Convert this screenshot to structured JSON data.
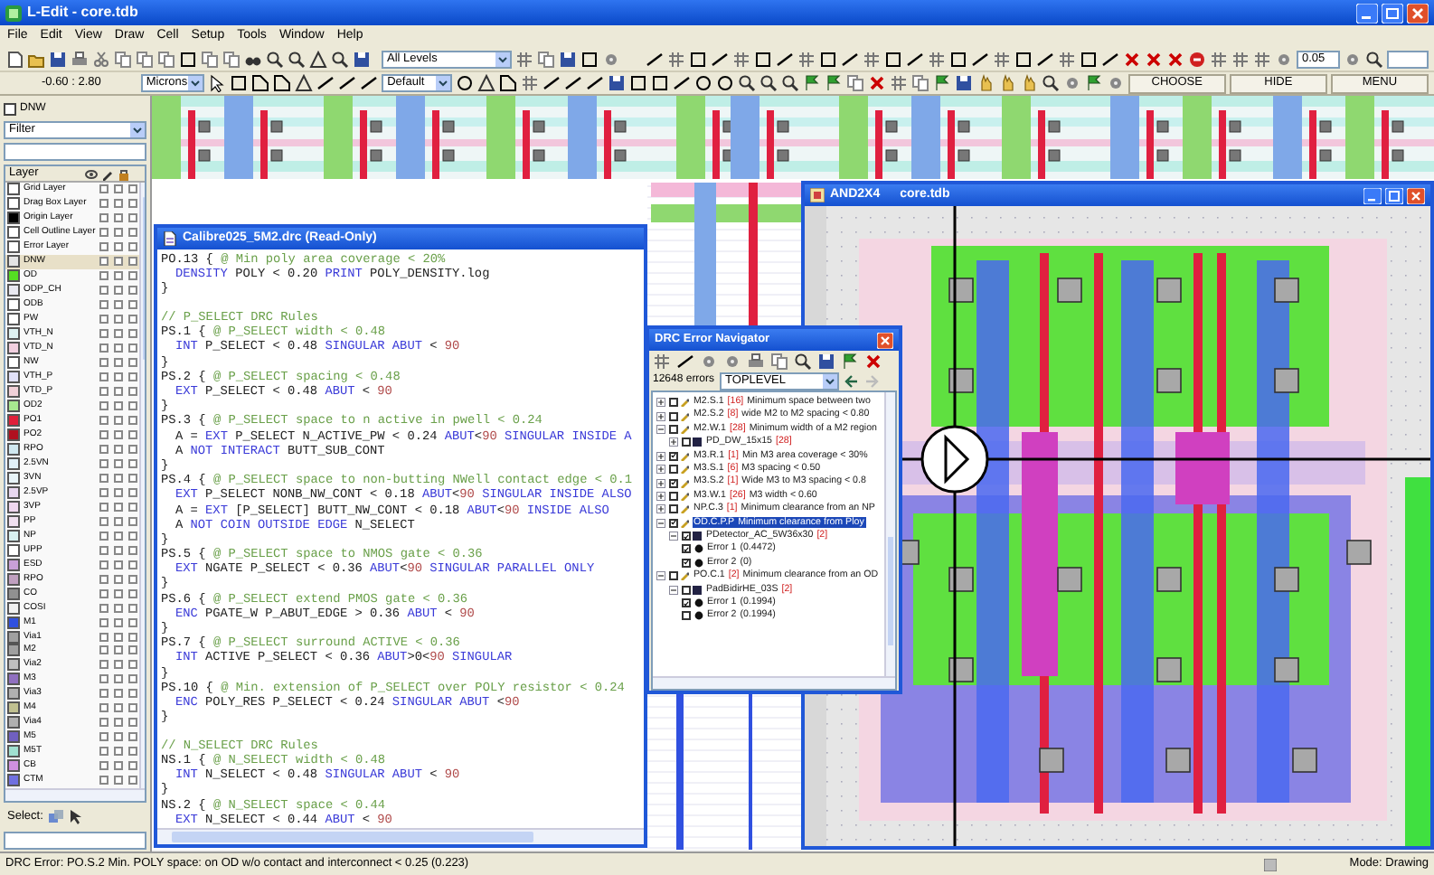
{
  "window": {
    "title": "L-Edit - core.tdb"
  },
  "menu": [
    "File",
    "Edit",
    "View",
    "Draw",
    "Cell",
    "Setup",
    "Tools",
    "Window",
    "Help"
  ],
  "toolbar": {
    "level_dropdown": "All Levels",
    "snap_field": "0.05",
    "coordinates": "-0.60 : 2.80",
    "units_dropdown": "Microns",
    "style_dropdown": "Default",
    "buttons": [
      "CHOOSE",
      "HIDE",
      "MENU"
    ]
  },
  "layer_panel": {
    "top_checkbox": {
      "label": "DNW",
      "checked": false
    },
    "filter": "Filter",
    "header": "Layer",
    "select_label": "Select:",
    "layers": [
      {
        "name": "Grid Layer",
        "color": "#ffffff",
        "selected": false,
        "flags": [
          false,
          false,
          false
        ]
      },
      {
        "name": "Drag Box Layer",
        "color": "#ffffff",
        "selected": false,
        "flags": [
          false,
          false,
          false
        ]
      },
      {
        "name": "Origin Layer",
        "color": "#000000",
        "selected": false,
        "flags": [
          false,
          false,
          false
        ]
      },
      {
        "name": "Cell Outline Layer",
        "color": "#ffffff",
        "selected": false,
        "flags": [
          false,
          false,
          false
        ]
      },
      {
        "name": "Error Layer",
        "color": "#ffffff",
        "selected": false,
        "flags": [
          false,
          false,
          false
        ]
      },
      {
        "name": "DNW",
        "color": "#e4e4e4",
        "selected": true,
        "flags": [
          false,
          false,
          false
        ]
      },
      {
        "name": "OD",
        "color": "#55dd22",
        "selected": false,
        "flags": [
          false,
          false,
          false
        ]
      },
      {
        "name": "ODP_CH",
        "color": "#e8e8f0",
        "selected": false,
        "flags": [
          false,
          false,
          false
        ]
      },
      {
        "name": "ODB",
        "color": "#ffffff",
        "selected": false,
        "flags": [
          false,
          false,
          false
        ]
      },
      {
        "name": "PW",
        "color": "#ffffff",
        "selected": false,
        "flags": [
          false,
          false,
          false
        ]
      },
      {
        "name": "VTH_N",
        "color": "#dff2f2",
        "selected": false,
        "flags": [
          false,
          false,
          false
        ]
      },
      {
        "name": "VTD_N",
        "color": "#f2d0e0",
        "selected": false,
        "flags": [
          false,
          false,
          false
        ]
      },
      {
        "name": "NW",
        "color": "#ffffff",
        "selected": false,
        "flags": [
          false,
          false,
          false
        ]
      },
      {
        "name": "VTH_P",
        "color": "#e0e0f8",
        "selected": false,
        "flags": [
          false,
          false,
          false
        ]
      },
      {
        "name": "VTD_P",
        "color": "#f0d0d8",
        "selected": false,
        "flags": [
          false,
          false,
          false
        ]
      },
      {
        "name": "OD2",
        "color": "#a8e890",
        "selected": false,
        "flags": [
          false,
          false,
          false
        ]
      },
      {
        "name": "PO1",
        "color": "#e0203a",
        "selected": false,
        "flags": [
          false,
          false,
          false
        ]
      },
      {
        "name": "PO2",
        "color": "#b01020",
        "selected": false,
        "flags": [
          false,
          false,
          false
        ]
      },
      {
        "name": "RPO",
        "color": "#d0e8f0",
        "selected": false,
        "flags": [
          false,
          false,
          false
        ]
      },
      {
        "name": "2.5VN",
        "color": "#e0f0f8",
        "selected": false,
        "flags": [
          false,
          false,
          false
        ]
      },
      {
        "name": "3VN",
        "color": "#e8f4f8",
        "selected": false,
        "flags": [
          false,
          false,
          false
        ]
      },
      {
        "name": "2.5VP",
        "color": "#e8d8f0",
        "selected": false,
        "flags": [
          false,
          false,
          false
        ]
      },
      {
        "name": "3VP",
        "color": "#f0d8f0",
        "selected": false,
        "flags": [
          false,
          false,
          false
        ]
      },
      {
        "name": "PP",
        "color": "#f0e0f0",
        "selected": false,
        "flags": [
          false,
          false,
          false
        ]
      },
      {
        "name": "NP",
        "color": "#d8f0f0",
        "selected": false,
        "flags": [
          false,
          false,
          false
        ]
      },
      {
        "name": "UPP",
        "color": "#ffffff",
        "selected": false,
        "flags": [
          false,
          false,
          false
        ]
      },
      {
        "name": "ESD",
        "color": "#c8a0d8",
        "selected": false,
        "flags": [
          false,
          false,
          false
        ]
      },
      {
        "name": "RPO",
        "color": "#c0a0c0",
        "selected": false,
        "flags": [
          false,
          false,
          false
        ]
      },
      {
        "name": "CO",
        "color": "#909090",
        "selected": false,
        "flags": [
          false,
          false,
          false
        ]
      },
      {
        "name": "COSI",
        "color": "#f0f0f0",
        "selected": false,
        "flags": [
          false,
          false,
          false
        ]
      },
      {
        "name": "M1",
        "color": "#3050e0",
        "selected": false,
        "flags": [
          false,
          false,
          false
        ]
      },
      {
        "name": "Via1",
        "color": "#a0a0a0",
        "selected": false,
        "flags": [
          false,
          false,
          false
        ]
      },
      {
        "name": "M2",
        "color": "#a0a0a0",
        "selected": false,
        "flags": [
          false,
          false,
          false
        ]
      },
      {
        "name": "Via2",
        "color": "#c0c0c0",
        "selected": false,
        "flags": [
          false,
          false,
          false
        ]
      },
      {
        "name": "M3",
        "color": "#9070c0",
        "selected": false,
        "flags": [
          false,
          false,
          false
        ]
      },
      {
        "name": "Via3",
        "color": "#b0b0b0",
        "selected": false,
        "flags": [
          false,
          false,
          false
        ]
      },
      {
        "name": "M4",
        "color": "#c0c090",
        "selected": false,
        "flags": [
          false,
          false,
          false
        ]
      },
      {
        "name": "Via4",
        "color": "#b0b0b0",
        "selected": false,
        "flags": [
          false,
          false,
          false
        ]
      },
      {
        "name": "M5",
        "color": "#7060c0",
        "selected": false,
        "flags": [
          false,
          false,
          false
        ]
      },
      {
        "name": "M5T",
        "color": "#a0e0d0",
        "selected": false,
        "flags": [
          false,
          false,
          false
        ]
      },
      {
        "name": "CB",
        "color": "#d090e0",
        "selected": false,
        "flags": [
          false,
          false,
          false
        ]
      },
      {
        "name": "CTM",
        "color": "#7070e0",
        "selected": false,
        "flags": [
          false,
          false,
          false
        ]
      }
    ]
  },
  "code_window": {
    "title": "Calibre025_5M2.drc (Read-Only)",
    "lines": [
      {
        "kind": "text",
        "indented": false,
        "segments": [
          {
            "text": "PO.13 { ",
            "kind": "plain"
          },
          {
            "text": "@ Min poly area coverage < 20%",
            "kind": "comment"
          }
        ]
      },
      {
        "kind": "text",
        "indented": true,
        "segments": [
          {
            "text": "DENSITY",
            "kind": "keyword"
          },
          {
            "text": " POLY < 0.20 ",
            "kind": "plain"
          },
          {
            "text": "PRINT",
            "kind": "keyword"
          },
          {
            "text": " POLY_DENSITY.log",
            "kind": "plain"
          }
        ]
      },
      {
        "kind": "text",
        "indented": false,
        "segments": [
          {
            "text": "}",
            "kind": "plain"
          }
        ]
      },
      {
        "kind": "blank"
      },
      {
        "kind": "text",
        "indented": false,
        "segments": [
          {
            "text": "// P_SELECT DRC Rules",
            "kind": "comment"
          }
        ]
      },
      {
        "kind": "text",
        "indented": false,
        "segments": [
          {
            "text": "PS.1 { ",
            "kind": "plain"
          },
          {
            "text": "@ P_SELECT width < 0.48",
            "kind": "comment"
          }
        ]
      },
      {
        "kind": "text",
        "indented": true,
        "segments": [
          {
            "text": "INT",
            "kind": "keyword"
          },
          {
            "text": " P_SELECT < 0.48 ",
            "kind": "plain"
          },
          {
            "text": "SINGULAR ABUT",
            "kind": "keyword"
          },
          {
            "text": " < ",
            "kind": "plain"
          },
          {
            "text": "90",
            "kind": "number"
          }
        ]
      },
      {
        "kind": "text",
        "indented": false,
        "segments": [
          {
            "text": "}",
            "kind": "plain"
          }
        ]
      },
      {
        "kind": "text",
        "indented": false,
        "segments": [
          {
            "text": "PS.2 { ",
            "kind": "plain"
          },
          {
            "text": "@ P_SELECT spacing < 0.48",
            "kind": "comment"
          }
        ]
      },
      {
        "kind": "text",
        "indented": true,
        "segments": [
          {
            "text": "EXT",
            "kind": "keyword"
          },
          {
            "text": " P_SELECT < 0.48 ",
            "kind": "plain"
          },
          {
            "text": "ABUT",
            "kind": "keyword"
          },
          {
            "text": " < ",
            "kind": "plain"
          },
          {
            "text": "90",
            "kind": "number"
          }
        ]
      },
      {
        "kind": "text",
        "indented": false,
        "segments": [
          {
            "text": "}",
            "kind": "plain"
          }
        ]
      },
      {
        "kind": "text",
        "indented": false,
        "segments": [
          {
            "text": "PS.3 { ",
            "kind": "plain"
          },
          {
            "text": "@ P_SELECT space to n active in pwell < 0.24",
            "kind": "comment"
          }
        ]
      },
      {
        "kind": "text",
        "indented": true,
        "segments": [
          {
            "text": "A = ",
            "kind": "plain"
          },
          {
            "text": "EXT",
            "kind": "keyword"
          },
          {
            "text": " P_SELECT N_ACTIVE_PW < 0.24 ",
            "kind": "plain"
          },
          {
            "text": "ABUT",
            "kind": "keyword"
          },
          {
            "text": "<",
            "kind": "plain"
          },
          {
            "text": "90",
            "kind": "number"
          },
          {
            "text": " SINGULAR INSIDE A",
            "kind": "keyword"
          }
        ]
      },
      {
        "kind": "text",
        "indented": true,
        "segments": [
          {
            "text": "A ",
            "kind": "plain"
          },
          {
            "text": "NOT INTERACT",
            "kind": "keyword"
          },
          {
            "text": " BUTT_SUB_CONT",
            "kind": "plain"
          }
        ]
      },
      {
        "kind": "text",
        "indented": false,
        "segments": [
          {
            "text": "}",
            "kind": "plain"
          }
        ]
      },
      {
        "kind": "text",
        "indented": false,
        "segments": [
          {
            "text": "PS.4 { ",
            "kind": "plain"
          },
          {
            "text": "@ P_SELECT space to non-butting NWell contact edge < 0.1",
            "kind": "comment"
          }
        ]
      },
      {
        "kind": "text",
        "indented": true,
        "segments": [
          {
            "text": "EXT",
            "kind": "keyword"
          },
          {
            "text": " P_SELECT NONB_NW_CONT < 0.18 ",
            "kind": "plain"
          },
          {
            "text": "ABUT",
            "kind": "keyword"
          },
          {
            "text": "<",
            "kind": "plain"
          },
          {
            "text": "90",
            "kind": "number"
          },
          {
            "text": " SINGULAR INSIDE ALSO",
            "kind": "keyword"
          }
        ]
      },
      {
        "kind": "text",
        "indented": true,
        "segments": [
          {
            "text": "A = ",
            "kind": "plain"
          },
          {
            "text": "EXT",
            "kind": "keyword"
          },
          {
            "text": " [P_SELECT] BUTT_NW_CONT < 0.18 ",
            "kind": "plain"
          },
          {
            "text": "ABUT",
            "kind": "keyword"
          },
          {
            "text": "<",
            "kind": "plain"
          },
          {
            "text": "90",
            "kind": "number"
          },
          {
            "text": " INSIDE ALSO",
            "kind": "keyword"
          }
        ]
      },
      {
        "kind": "text",
        "indented": true,
        "segments": [
          {
            "text": "A ",
            "kind": "plain"
          },
          {
            "text": "NOT COIN OUTSIDE EDGE",
            "kind": "keyword"
          },
          {
            "text": " N_SELECT",
            "kind": "plain"
          }
        ]
      },
      {
        "kind": "text",
        "indented": false,
        "segments": [
          {
            "text": "}",
            "kind": "plain"
          }
        ]
      },
      {
        "kind": "text",
        "indented": false,
        "segments": [
          {
            "text": "PS.5 { ",
            "kind": "plain"
          },
          {
            "text": "@ P_SELECT space to NMOS gate < 0.36",
            "kind": "comment"
          }
        ]
      },
      {
        "kind": "text",
        "indented": true,
        "segments": [
          {
            "text": "EXT",
            "kind": "keyword"
          },
          {
            "text": " NGATE P_SELECT < 0.36 ",
            "kind": "plain"
          },
          {
            "text": "ABUT",
            "kind": "keyword"
          },
          {
            "text": "<",
            "kind": "plain"
          },
          {
            "text": "90",
            "kind": "number"
          },
          {
            "text": " SINGULAR PARALLEL ONLY",
            "kind": "keyword"
          }
        ]
      },
      {
        "kind": "text",
        "indented": false,
        "segments": [
          {
            "text": "}",
            "kind": "plain"
          }
        ]
      },
      {
        "kind": "text",
        "indented": false,
        "segments": [
          {
            "text": "PS.6 { ",
            "kind": "plain"
          },
          {
            "text": "@ P_SELECT extend PMOS gate < 0.36",
            "kind": "comment"
          }
        ]
      },
      {
        "kind": "text",
        "indented": true,
        "segments": [
          {
            "text": "ENC",
            "kind": "keyword"
          },
          {
            "text": " PGATE_W P_ABUT_EDGE > 0.36 ",
            "kind": "plain"
          },
          {
            "text": "ABUT",
            "kind": "keyword"
          },
          {
            "text": " < ",
            "kind": "plain"
          },
          {
            "text": "90",
            "kind": "number"
          }
        ]
      },
      {
        "kind": "text",
        "indented": false,
        "segments": [
          {
            "text": "}",
            "kind": "plain"
          }
        ]
      },
      {
        "kind": "text",
        "indented": false,
        "segments": [
          {
            "text": "PS.7 { ",
            "kind": "plain"
          },
          {
            "text": "@ P_SELECT surround ACTIVE < 0.36",
            "kind": "comment"
          }
        ]
      },
      {
        "kind": "text",
        "indented": true,
        "segments": [
          {
            "text": "INT",
            "kind": "keyword"
          },
          {
            "text": " ACTIVE P_SELECT < 0.36 ",
            "kind": "plain"
          },
          {
            "text": "ABUT",
            "kind": "keyword"
          },
          {
            "text": ">0<",
            "kind": "plain"
          },
          {
            "text": "90",
            "kind": "number"
          },
          {
            "text": " SINGULAR",
            "kind": "keyword"
          }
        ]
      },
      {
        "kind": "text",
        "indented": false,
        "segments": [
          {
            "text": "}",
            "kind": "plain"
          }
        ]
      },
      {
        "kind": "text",
        "indented": false,
        "segments": [
          {
            "text": "PS.10 { ",
            "kind": "plain"
          },
          {
            "text": "@ Min. extension of P_SELECT over POLY resistor < 0.24",
            "kind": "comment"
          }
        ]
      },
      {
        "kind": "text",
        "indented": true,
        "segments": [
          {
            "text": "ENC",
            "kind": "keyword"
          },
          {
            "text": " POLY_RES P_SELECT < 0.24 ",
            "kind": "plain"
          },
          {
            "text": "SINGULAR ABUT",
            "kind": "keyword"
          },
          {
            "text": " <",
            "kind": "plain"
          },
          {
            "text": "90",
            "kind": "number"
          }
        ]
      },
      {
        "kind": "text",
        "indented": false,
        "segments": [
          {
            "text": "}",
            "kind": "plain"
          }
        ]
      },
      {
        "kind": "blank"
      },
      {
        "kind": "text",
        "indented": false,
        "segments": [
          {
            "text": "// N_SELECT DRC Rules",
            "kind": "comment"
          }
        ]
      },
      {
        "kind": "text",
        "indented": false,
        "segments": [
          {
            "text": "NS.1 { ",
            "kind": "plain"
          },
          {
            "text": "@ N_SELECT width < 0.48",
            "kind": "comment"
          }
        ]
      },
      {
        "kind": "text",
        "indented": true,
        "segments": [
          {
            "text": "INT",
            "kind": "keyword"
          },
          {
            "text": " N_SELECT < 0.48 ",
            "kind": "plain"
          },
          {
            "text": "SINGULAR ABUT",
            "kind": "keyword"
          },
          {
            "text": " < ",
            "kind": "plain"
          },
          {
            "text": "90",
            "kind": "number"
          }
        ]
      },
      {
        "kind": "text",
        "indented": false,
        "segments": [
          {
            "text": "}",
            "kind": "plain"
          }
        ]
      },
      {
        "kind": "text",
        "indented": false,
        "segments": [
          {
            "text": "NS.2 { ",
            "kind": "plain"
          },
          {
            "text": "@ N_SELECT space < 0.44",
            "kind": "comment"
          }
        ]
      },
      {
        "kind": "text",
        "indented": true,
        "segments": [
          {
            "text": "EXT",
            "kind": "keyword"
          },
          {
            "text": " N_SELECT < 0.44 ",
            "kind": "plain"
          },
          {
            "text": "ABUT",
            "kind": "keyword"
          },
          {
            "text": " < ",
            "kind": "plain"
          },
          {
            "text": "90",
            "kind": "number"
          }
        ]
      }
    ]
  },
  "drc_navigator": {
    "title": "DRC Error Navigator",
    "error_count": "12648 errors",
    "cell_dropdown": "TOPLEVEL",
    "items": [
      {
        "kind": "rule",
        "code": "M2.S.1",
        "count": "[16]",
        "text": "Minimum space between two",
        "checked": false,
        "expanded": false,
        "selected": false
      },
      {
        "kind": "rule",
        "code": "M2.S.2",
        "count": "[8]",
        "text": "wide M2 to M2 spacing < 0.80",
        "checked": false,
        "expanded": false,
        "selected": false
      },
      {
        "kind": "rule",
        "code": "M2.W.1",
        "count": "[28]",
        "text": "Minimum width of a M2 region",
        "checked": false,
        "expanded": true,
        "selected": false,
        "children": [
          {
            "kind": "cell",
            "code": "PD_DW_15x15",
            "count": "[28]",
            "checked": false,
            "expanded": false,
            "selected": false
          }
        ]
      },
      {
        "kind": "rule",
        "code": "M3.R.1",
        "count": "[1]",
        "text": "Min M3 area coverage < 30%",
        "checked": true,
        "expanded": false,
        "selected": false
      },
      {
        "kind": "rule",
        "code": "M3.S.1",
        "count": "[6]",
        "text": "M3 spacing < 0.50",
        "checked": false,
        "expanded": false,
        "selected": false
      },
      {
        "kind": "rule",
        "code": "M3.S.2",
        "count": "[1]",
        "text": "Wide M3 to M3 spacing < 0.8",
        "checked": true,
        "expanded": false,
        "selected": false
      },
      {
        "kind": "rule",
        "code": "M3.W.1",
        "count": "[26]",
        "text": "M3 width < 0.60",
        "checked": false,
        "expanded": false,
        "selected": false
      },
      {
        "kind": "rule",
        "code": "NP.C.3",
        "count": "[1]",
        "text": "Minimum clearance from an NP",
        "checked": false,
        "expanded": false,
        "selected": false
      },
      {
        "kind": "rule",
        "code": "OD.C.P.P",
        "text": "Minimum clearance from Ploy",
        "checked": true,
        "expanded": true,
        "selected": true,
        "children": [
          {
            "kind": "cell",
            "code": "PDetector_AC_5W36x30",
            "count": "[2]",
            "checked": true,
            "expanded": true,
            "selected": false,
            "children": [
              {
                "kind": "error",
                "code": "Error 1",
                "text": "(0.4472)",
                "checked": true,
                "selected": false
              },
              {
                "kind": "error",
                "code": "Error 2",
                "text": "(0)",
                "checked": true,
                "selected": false
              }
            ]
          }
        ]
      },
      {
        "kind": "rule",
        "code": "PO.C.1",
        "count": "[2]",
        "text": "Minimum clearance from an OD",
        "checked": false,
        "expanded": true,
        "selected": false,
        "children": [
          {
            "kind": "cell",
            "code": "PadBidirHE_03S",
            "count": "[2]",
            "checked": false,
            "expanded": true,
            "selected": false,
            "children": [
              {
                "kind": "error",
                "code": "Error 1",
                "text": "(0.1994)",
                "checked": true,
                "selected": false
              },
              {
                "kind": "error",
                "code": "Error 2",
                "text": "(0.1994)",
                "checked": false,
                "selected": false
              }
            ]
          }
        ]
      }
    ]
  },
  "layout_window": {
    "title": "AND2X4",
    "file": "core.tdb"
  },
  "status_bar": {
    "message": "DRC Error: PO.S.2 Min. POLY space: on OD w/o contact and interconnect < 0.25 (0.223)",
    "mode": "Mode: Drawing"
  }
}
